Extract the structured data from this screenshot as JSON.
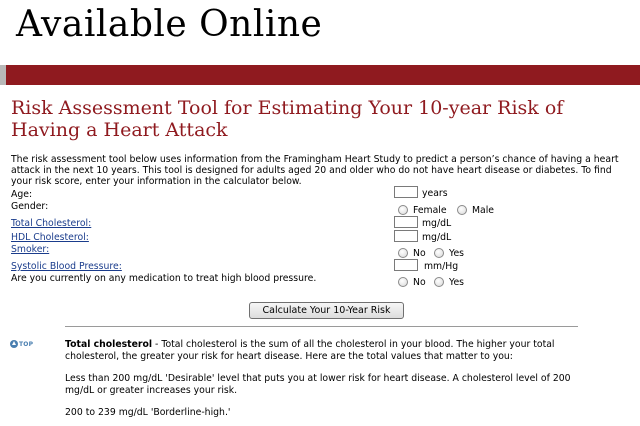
{
  "banner": {
    "title": "Available Online"
  },
  "heading": "Risk Assessment Tool for Estimating Your 10-year Risk of Having a Heart Attack",
  "intro": "The risk assessment tool below uses information from the Framingham Heart Study to predict a person’s chance of having a heart attack in the next 10 years. This tool is designed for adults aged 20 and older who do not have heart disease or diabetes. To find your risk score, enter your information in the calculator below.",
  "form": {
    "age_label": "Age:",
    "age_unit": "years",
    "gender_label": "Gender:",
    "gender_female": "Female",
    "gender_male": "Male",
    "cholesterol_label": "Total Cholesterol:",
    "cholesterol_unit": "mg/dL",
    "hdl_label": "HDL Cholesterol:",
    "hdl_unit": "mg/dL",
    "smoker_label": "Smoker:",
    "smoker_no": "No",
    "smoker_yes": "Yes",
    "bp_label": "Systolic Blood Pressure:",
    "bp_unit": "mm/Hg",
    "medication_label": "Are you currently on any medication to treat high blood pressure.",
    "medication_no": "No",
    "medication_yes": "Yes",
    "calculate_button": "Calculate Your 10-Year Risk"
  },
  "top_link": "TOP",
  "info": {
    "term": "Total cholesterol",
    "definition": " - Total cholesterol is the sum of all the cholesterol in your blood. The higher your total cholesterol, the greater your risk for heart disease. Here are the total values that matter to you:",
    "item1": "Less than 200 mg/dL 'Desirable' level that puts you at lower risk for heart disease. A cholesterol level of 200 mg/dL or greater increases your risk.",
    "item2": "200 to 239 mg/dL 'Borderline-high.'"
  }
}
